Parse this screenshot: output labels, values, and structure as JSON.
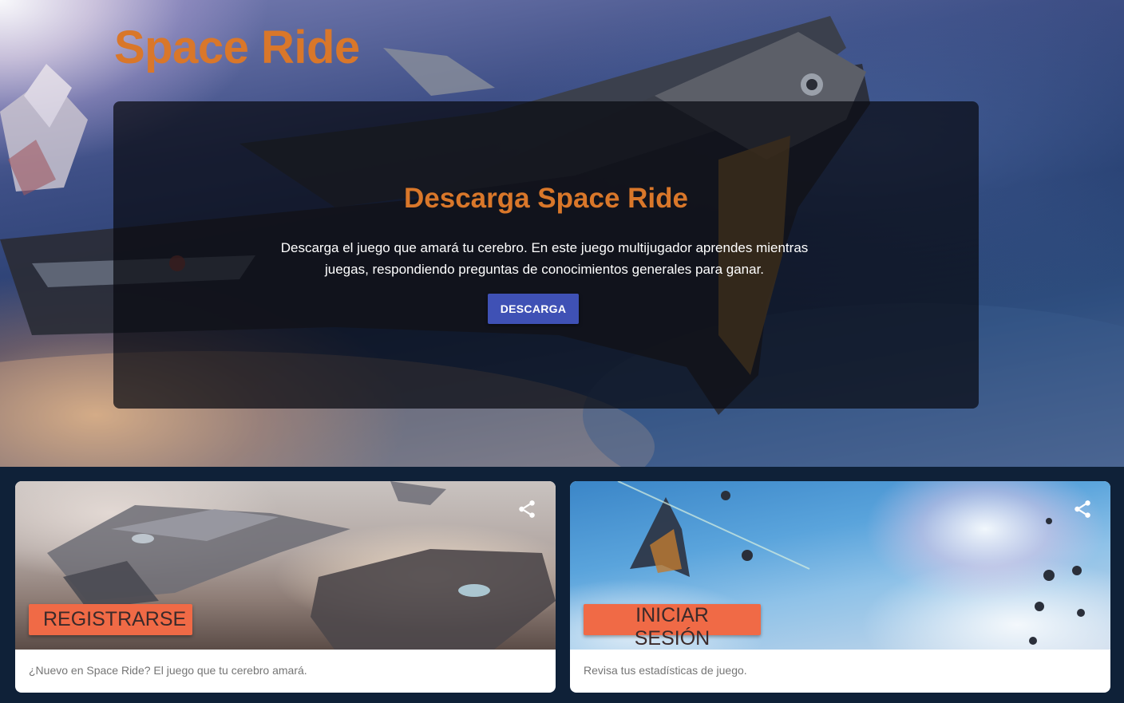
{
  "brand": {
    "title": "Space Ride",
    "color": "#d9772a"
  },
  "hero": {
    "heading": "Descarga Space Ride",
    "description": "Descarga el juego que amará tu cerebro. En este juego multijugador aprendes mientras juegas, respondiendo preguntas de conocimientos generales para ganar.",
    "button_label": "DESCARGA",
    "button_color": "#3f51b5"
  },
  "cards": [
    {
      "label": "REGISTRARSE",
      "text": "¿Nuevo en Space Ride? El juego que tu cerebro amará.",
      "icon": "share-icon"
    },
    {
      "label": "INICIAR SESIÓN",
      "text": "Revisa tus estadísticas de juego.",
      "icon": "share-icon"
    }
  ],
  "colors": {
    "accent_orange": "#f06a46",
    "page_background": "#0f2138",
    "card_background": "#ffffff",
    "card_text": "#757575"
  }
}
